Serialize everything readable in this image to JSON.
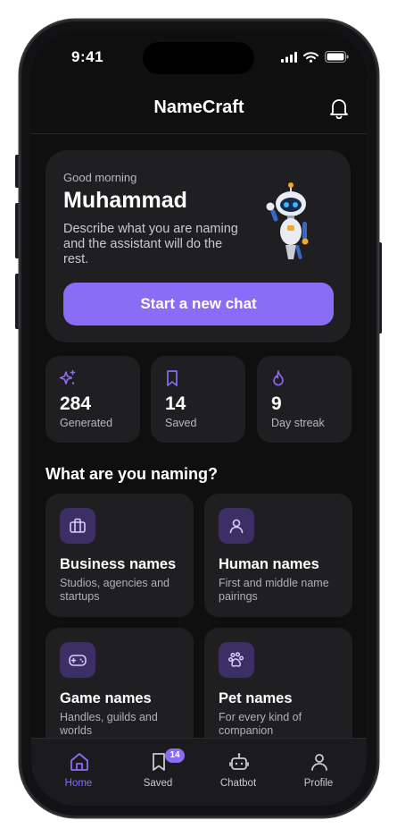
{
  "status": {
    "time": "9:41"
  },
  "header": {
    "title": "NameCraft"
  },
  "greeting": {
    "small": "Good morning",
    "name": "Muhammad",
    "description": "Describe what you are naming and the assistant will do the rest.",
    "cta_label": "Start a new chat"
  },
  "stats": [
    {
      "icon": "sparkles-icon",
      "value": "284",
      "label": "Generated"
    },
    {
      "icon": "bookmark-icon",
      "value": "14",
      "label": "Saved"
    },
    {
      "icon": "flame-icon",
      "value": "9",
      "label": "Day streak"
    }
  ],
  "section": {
    "title": "What are you naming?"
  },
  "categories": [
    {
      "icon": "briefcase-icon",
      "title": "Business names",
      "desc": "Studios, agencies and startups"
    },
    {
      "icon": "person-icon",
      "title": "Human names",
      "desc": "First and middle name pairings"
    },
    {
      "icon": "gamepad-icon",
      "title": "Game names",
      "desc": "Handles, guilds and worlds"
    },
    {
      "icon": "paw-icon",
      "title": "Pet names",
      "desc": "For every kind of companion"
    }
  ],
  "tabs": [
    {
      "icon": "home-icon",
      "label": "Home",
      "active": true
    },
    {
      "icon": "bookmark-icon",
      "label": "Saved",
      "badge": "14"
    },
    {
      "icon": "robot-icon",
      "label": "Chatbot"
    },
    {
      "icon": "profile-icon",
      "label": "Profile"
    }
  ],
  "colors": {
    "accent": "#8b6cf6",
    "card": "#1f1f22",
    "background": "#0f0f10",
    "icon_box": "#3b2f66"
  }
}
